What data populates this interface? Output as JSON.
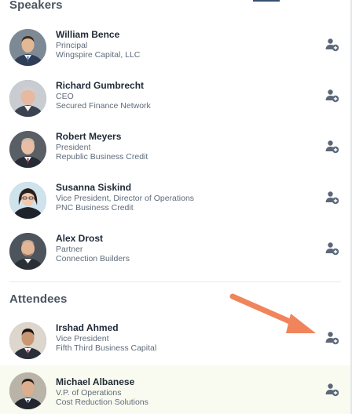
{
  "speakers": {
    "title": "Speakers",
    "people": [
      {
        "name": "William Bence",
        "role": "Principal",
        "company": "Wingspire Capital, LLC"
      },
      {
        "name": "Richard Gumbrecht",
        "role": "CEO",
        "company": "Secured Finance Network"
      },
      {
        "name": "Robert Meyers",
        "role": "President",
        "company": "Republic Business Credit"
      },
      {
        "name": "Susanna Siskind",
        "role": "Vice President, Director of Operations",
        "company": "PNC Business Credit"
      },
      {
        "name": "Alex Drost",
        "role": "Partner",
        "company": "Connection Builders"
      }
    ]
  },
  "attendees": {
    "title": "Attendees",
    "people": [
      {
        "name": "Irshad Ahmed",
        "role": "Vice President",
        "company": "Fifth Third Business Capital"
      },
      {
        "name": "Michael Albanese",
        "role": "V.P. of Operations",
        "company": "Cost Reduction Solutions"
      }
    ]
  },
  "icons": {
    "add_contact": "add-person-icon",
    "annotation": "arrow-annotation"
  },
  "colors": {
    "name_text": "#1f2a37",
    "detail_text": "#5f6b7a",
    "section_title": "#4b5563",
    "icon": "#5c6878",
    "annotation_arrow": "#f0845a",
    "highlight_row": "#fafbf0"
  }
}
